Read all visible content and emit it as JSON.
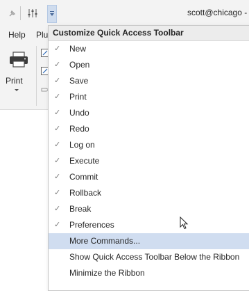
{
  "titlebar": {
    "title": "scott@chicago - P",
    "icons": [
      "pin-icon",
      "tune-icon",
      "customize-dropdown-icon"
    ]
  },
  "ribbon": {
    "tabs": [
      "Help",
      "Plu"
    ],
    "print_label": "Print"
  },
  "menu": {
    "header": "Customize Quick Access Toolbar",
    "items": [
      {
        "label": "New",
        "checked": true
      },
      {
        "label": "Open",
        "checked": true
      },
      {
        "label": "Save",
        "checked": true
      },
      {
        "label": "Print",
        "checked": true
      },
      {
        "label": "Undo",
        "checked": true
      },
      {
        "label": "Redo",
        "checked": true
      },
      {
        "label": "Log on",
        "checked": true
      },
      {
        "label": "Execute",
        "checked": true
      },
      {
        "label": "Commit",
        "checked": true
      },
      {
        "label": "Rollback",
        "checked": true
      },
      {
        "label": "Break",
        "checked": true
      },
      {
        "label": "Preferences",
        "checked": true
      }
    ],
    "more_commands": "More Commands...",
    "show_below": "Show Quick Access Toolbar Below the Ribbon",
    "minimize": "Minimize the Ribbon",
    "check_glyph": "✓"
  },
  "colors": {
    "highlight": "#d0ddf0",
    "titlebar_bg": "#f3f3f3"
  }
}
